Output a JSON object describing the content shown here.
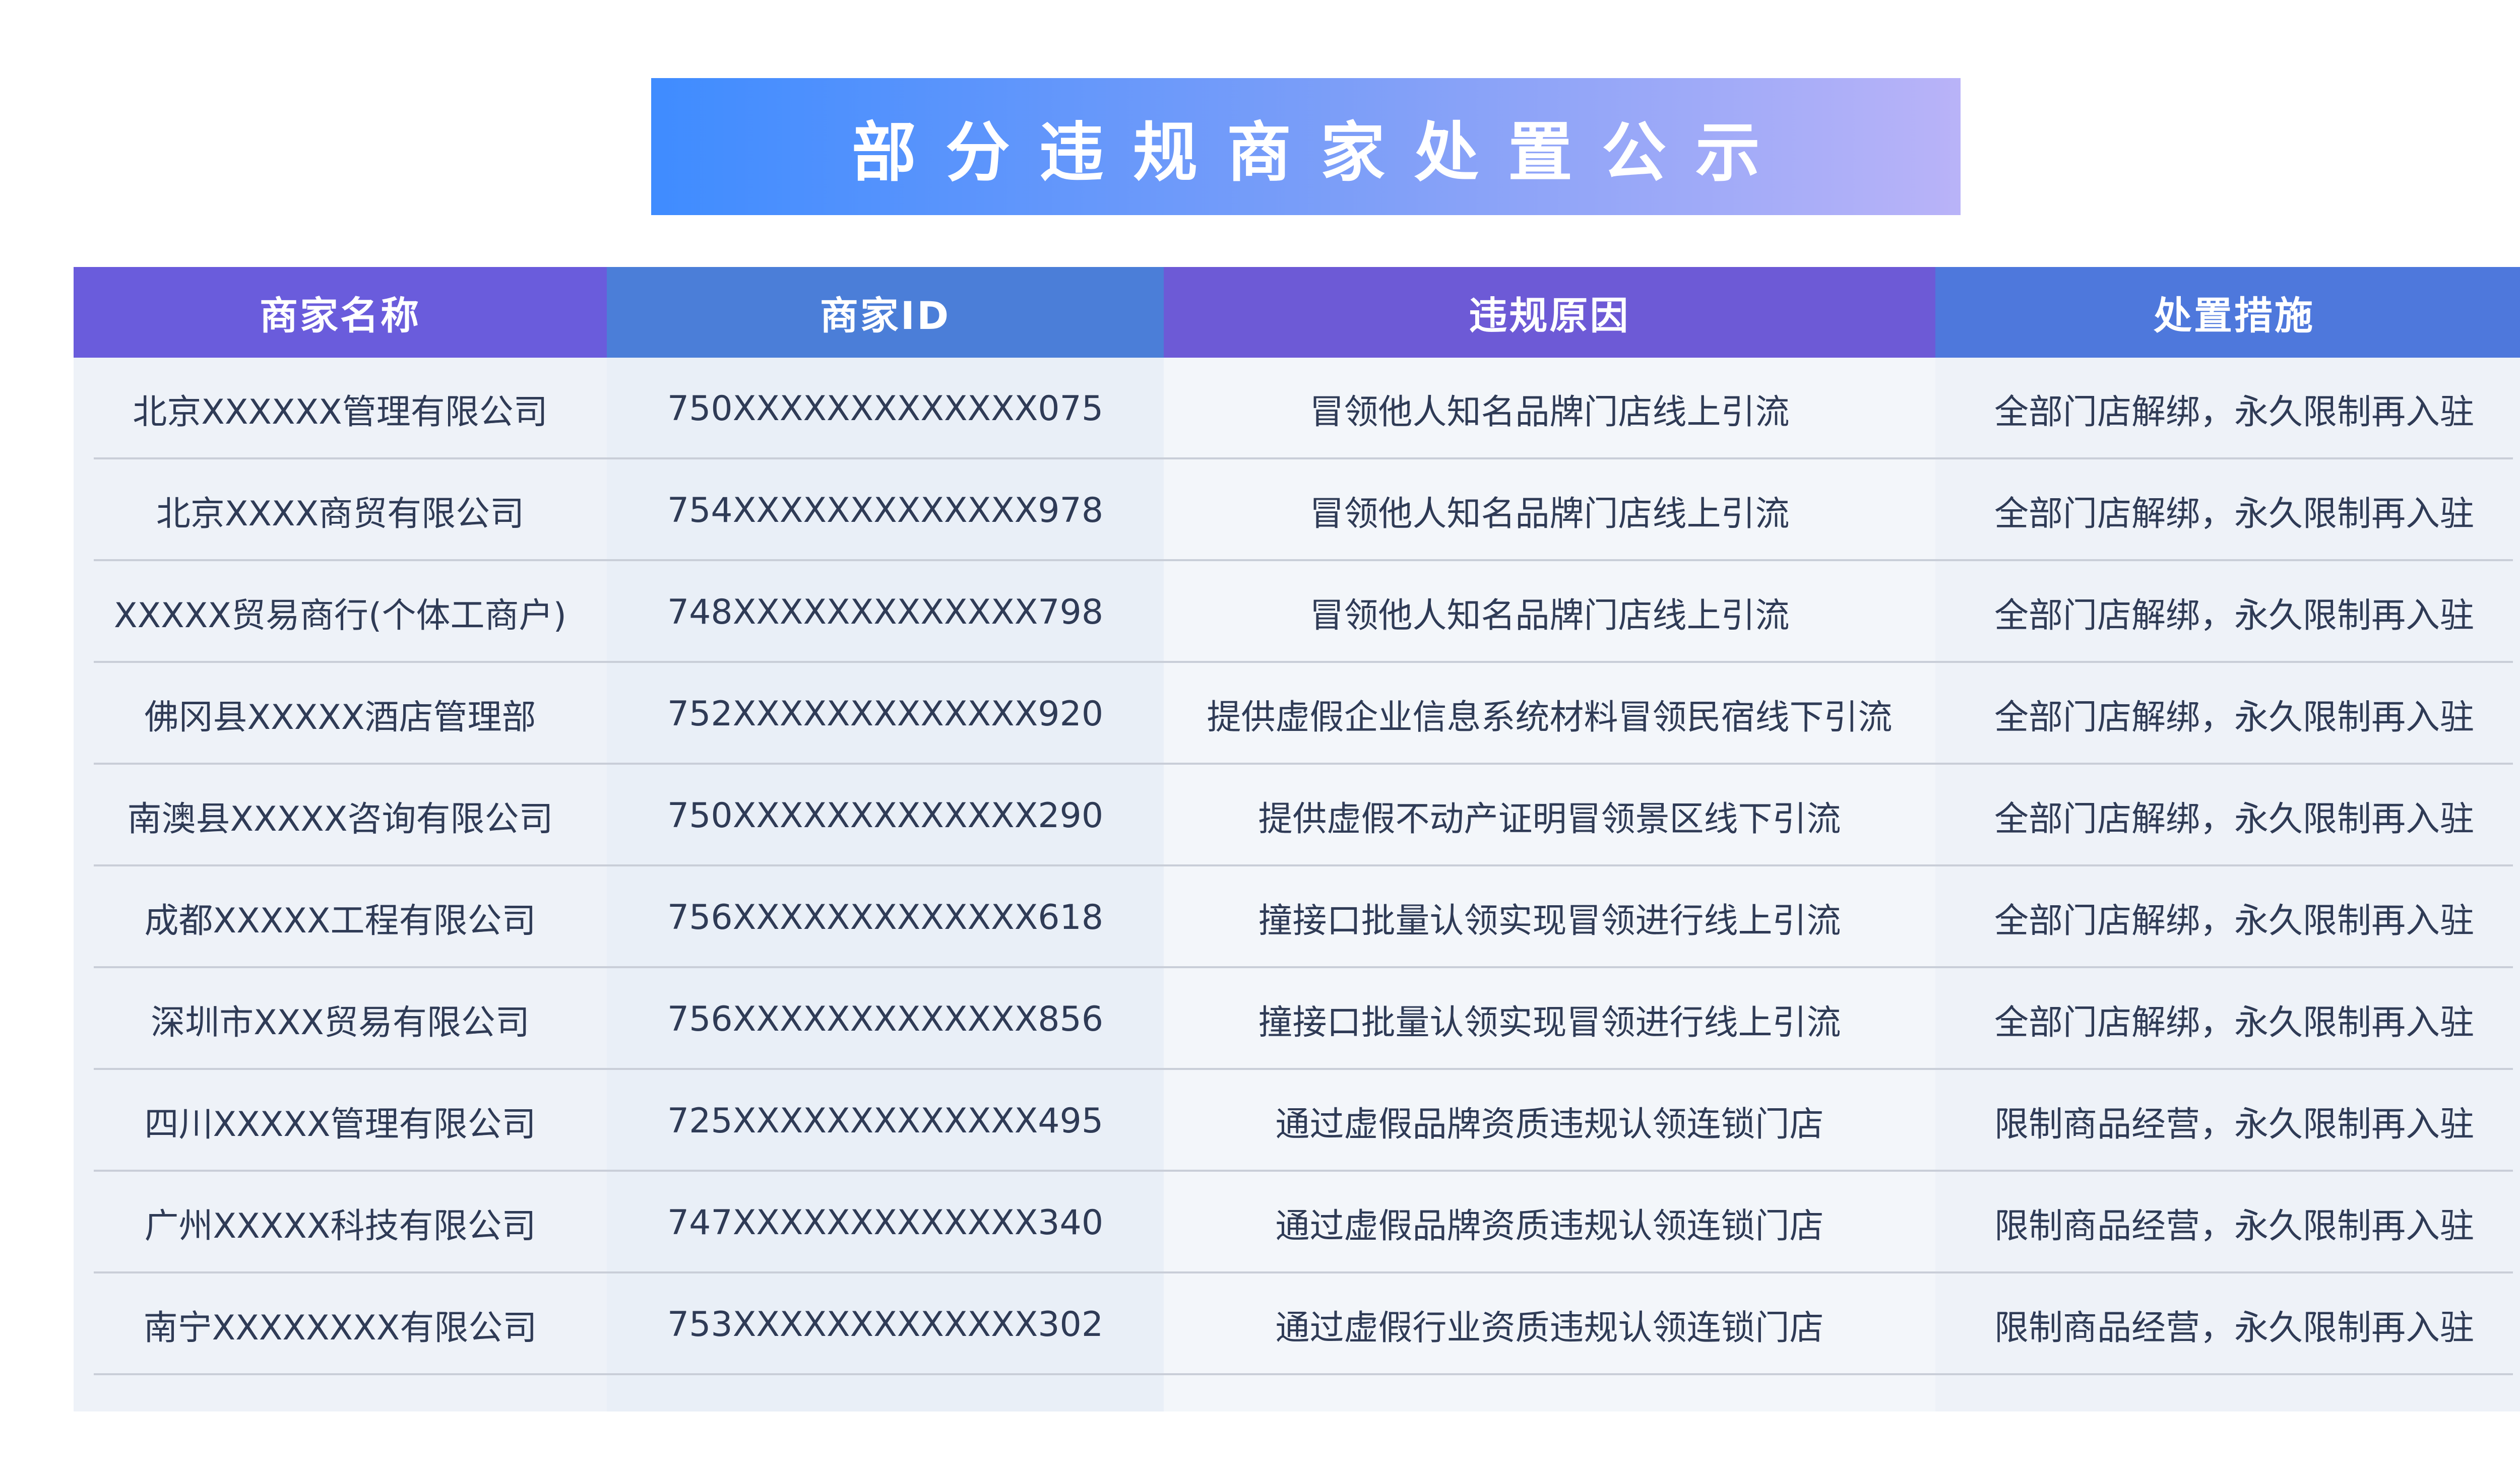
{
  "title": "部分违规商家处置公示",
  "table": {
    "headers": [
      "商家名称",
      "商家ID",
      "违规原因",
      "处置措施"
    ],
    "header_colors": [
      "#6a5cdc",
      "#4b7ed8",
      "#6d5ad6",
      "#4e78dc"
    ],
    "rows": [
      [
        "北京XXXXXX管理有限公司",
        "750XXXXXXXXXXXXX075",
        "冒领他人知名品牌门店线上引流",
        "全部门店解绑，永久限制再入驻"
      ],
      [
        "北京XXXX商贸有限公司",
        "754XXXXXXXXXXXXX978",
        "冒领他人知名品牌门店线上引流",
        "全部门店解绑，永久限制再入驻"
      ],
      [
        "XXXXX贸易商行(个体工商户)",
        "748XXXXXXXXXXXXX798",
        "冒领他人知名品牌门店线上引流",
        "全部门店解绑，永久限制再入驻"
      ],
      [
        "佛冈县XXXXX酒店管理部",
        "752XXXXXXXXXXXXX920",
        "提供虚假企业信息系统材料冒领民宿线下引流",
        "全部门店解绑，永久限制再入驻"
      ],
      [
        "南澳县XXXXX咨询有限公司",
        "750XXXXXXXXXXXXX290",
        "提供虚假不动产证明冒领景区线下引流",
        "全部门店解绑，永久限制再入驻"
      ],
      [
        "成都XXXXX工程有限公司",
        "756XXXXXXXXXXXXX618",
        "撞接口批量认领实现冒领进行线上引流",
        "全部门店解绑，永久限制再入驻"
      ],
      [
        "深圳市XXX贸易有限公司",
        "756XXXXXXXXXXXXX856",
        "撞接口批量认领实现冒领进行线上引流",
        "全部门店解绑，永久限制再入驻"
      ],
      [
        "四川XXXXX管理有限公司",
        "725XXXXXXXXXXXXX495",
        "通过虚假品牌资质违规认领连锁门店",
        "限制商品经营，永久限制再入驻"
      ],
      [
        "广州XXXXX科技有限公司",
        "747XXXXXXXXXXXXX340",
        "通过虚假品牌资质违规认领连锁门店",
        "限制商品经营，永久限制再入驻"
      ],
      [
        "南宁XXXXXXXX有限公司",
        "753XXXXXXXXXXXXX302",
        "通过虚假行业资质违规认领连锁门店",
        "限制商品经营，永久限制再入驻"
      ]
    ]
  }
}
